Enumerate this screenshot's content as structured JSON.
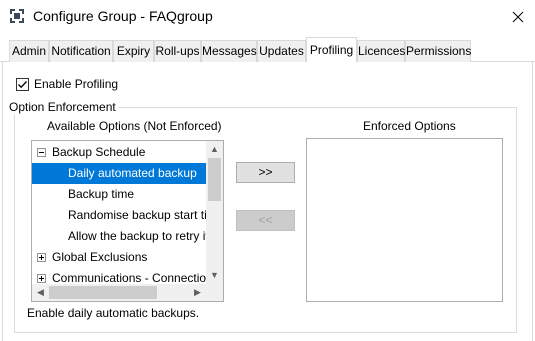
{
  "window": {
    "title": "Configure Group - FAQgroup",
    "close_glyph": "✕"
  },
  "tabs": [
    {
      "label": "Admin"
    },
    {
      "label": "Notification"
    },
    {
      "label": "Expiry"
    },
    {
      "label": "Roll-ups"
    },
    {
      "label": "Messages"
    },
    {
      "label": "Updates"
    },
    {
      "label": "Profiling",
      "active": true
    },
    {
      "label": "Licences"
    },
    {
      "label": "Permissions"
    }
  ],
  "profiling": {
    "enable_label": "Enable Profiling",
    "enable_checked": true,
    "group_title": "Option Enforcement",
    "available_header": "Available Options (Not Enforced)",
    "enforced_header": "Enforced Options",
    "tree": [
      {
        "label": "Backup Schedule",
        "expander": "minus"
      },
      {
        "label": "Daily automated backup",
        "selected": true
      },
      {
        "label": "Backup time"
      },
      {
        "label": "Randomise backup start time"
      },
      {
        "label": "Allow the backup to retry if it fails"
      },
      {
        "label": "Global Exclusions",
        "expander": "plus"
      },
      {
        "label": "Communications - Connection Timeouts",
        "expander": "plus"
      }
    ],
    "add_button": ">>",
    "remove_button": "<<",
    "description": "Enable daily automatic backups."
  },
  "icons": {
    "app": "group-gear-icon",
    "close": "close-icon",
    "check": "checkmark-icon"
  }
}
